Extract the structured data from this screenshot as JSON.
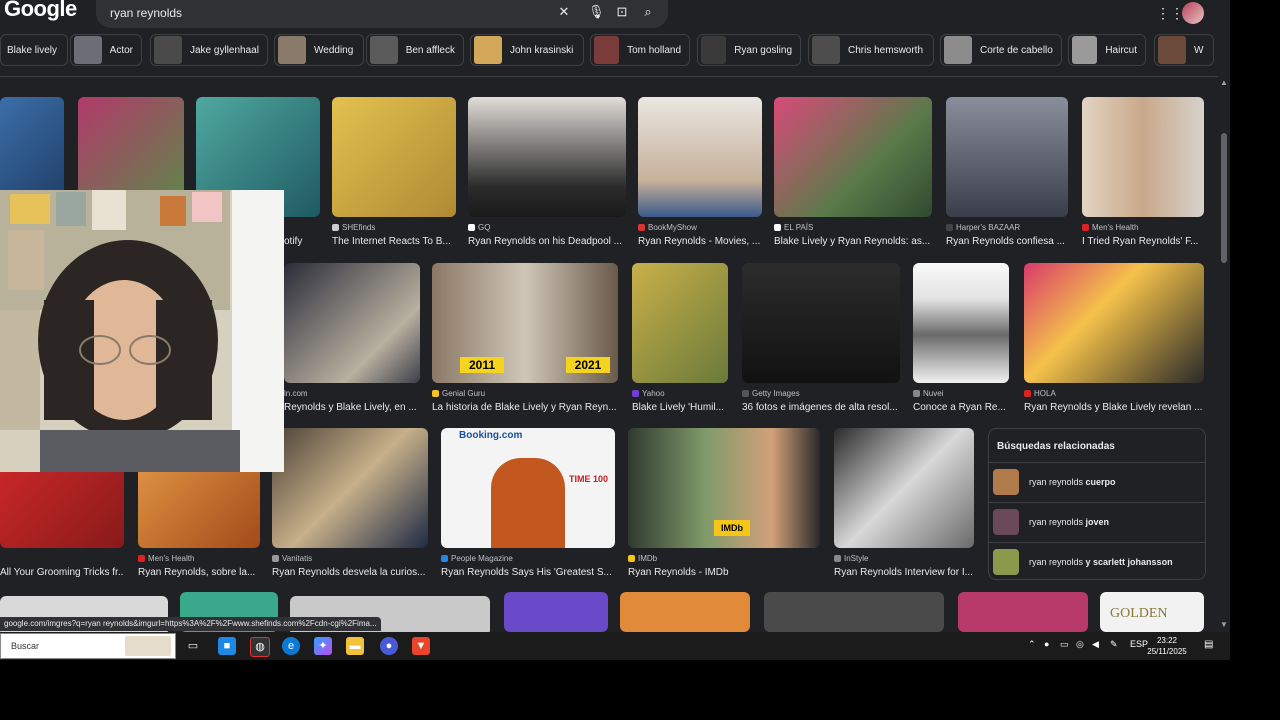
{
  "header": {
    "logo": "Google",
    "search_value": "ryan reynolds"
  },
  "chips": [
    {
      "label": "Blake lively",
      "color": "#2b2b2b"
    },
    {
      "label": "Actor",
      "color": "#6b6f75"
    },
    {
      "label": "Jake gyllenhaal",
      "color": "#4a4a4a"
    },
    {
      "label": "Wedding",
      "color": "#8a7a6a"
    },
    {
      "label": "Ben affleck",
      "color": "#5b5b5b"
    },
    {
      "label": "John krasinski",
      "color": "#d4a85a"
    },
    {
      "label": "Tom holland",
      "color": "#7a3b3b"
    },
    {
      "label": "Ryan gosling",
      "color": "#3a3a3a"
    },
    {
      "label": "Chris hemsworth",
      "color": "#4d4d4d"
    },
    {
      "label": "Corte de cabello",
      "color": "#8c8c8c"
    },
    {
      "label": "Haircut",
      "color": "#9a9a9a"
    },
    {
      "label": "W",
      "color": "#6b4a3a"
    }
  ],
  "row1": [
    {
      "source": "",
      "title": "",
      "color": "#3b6ea8"
    },
    {
      "source": "",
      "title": "",
      "color": "#b13a6a"
    },
    {
      "source": "",
      "title": "otify",
      "color": "#4fa8a0"
    },
    {
      "source": "SHEfinds",
      "title": "The Internet Reacts To B...",
      "color": "#d9b24a"
    },
    {
      "source": "GQ",
      "title": "Ryan Reynolds on his Deadpool ...",
      "color": "#d8d4cf"
    },
    {
      "source": "BookMyShow",
      "title": "Ryan Reynolds - Movies, ...",
      "color": "#e8e4e0"
    },
    {
      "source": "EL PAÍS",
      "title": "Blake Lively y Ryan Reynolds: as...",
      "color": "#9a4f7a"
    },
    {
      "source": "Harper's BAZAAR",
      "title": "Ryan Reynolds confiesa ...",
      "color": "#7a7e8a"
    },
    {
      "source": "Men's Health",
      "title": "I Tried Ryan Reynolds' F...",
      "color": "#d9cbbb"
    }
  ],
  "row2": [
    {
      "source": "ln.com",
      "title": "Reynolds y Blake Lively, en ...",
      "color": "#2a2c38"
    },
    {
      "source": "Genial Guru",
      "title": "La historia de Blake Lively y Ryan Reyn...",
      "color": "#8a7864"
    },
    {
      "source": "Yahoo",
      "title": "Blake Lively 'Humil...",
      "color": "#b9a24a"
    },
    {
      "source": "Getty Images",
      "title": "36 fotos e imágenes de alta resol...",
      "color": "#222222"
    },
    {
      "source": "Nuvei",
      "title": "Conoce a Ryan Re...",
      "color": "#f2f2f2"
    },
    {
      "source": "HOLA",
      "title": "Ryan Reynolds y Blake Lively revelan ...",
      "color": "#b23b5e"
    }
  ],
  "badges": {
    "left": "2011",
    "right": "2021"
  },
  "row3": [
    {
      "source": "",
      "title": "All Your Grooming Tricks fr...",
      "color": "#c42a2a"
    },
    {
      "source": "Men's Health",
      "title": "Ryan Reynolds, sobre la...",
      "color": "#d89a3a"
    },
    {
      "source": "Vanitatis",
      "title": "Ryan Reynolds desvela la curios...",
      "color": "#4a4136"
    },
    {
      "source": "People Magazine",
      "title": "Ryan Reynolds Says His 'Greatest S...",
      "color": "#f4f4f4"
    },
    {
      "source": "IMDb",
      "title": "Ryan Reynolds - IMDb",
      "color": "#3a3a3a"
    },
    {
      "source": "InStyle",
      "title": "Ryan Reynolds Interview for I...",
      "color": "#d8d8d8"
    }
  ],
  "people_overlay": {
    "brand": "Booking.com",
    "magazine": "TIME 100"
  },
  "imdb_overlay": "IMDb",
  "related": {
    "heading": "Búsquedas relacionadas",
    "items": [
      {
        "prefix": "ryan reynolds ",
        "bold": "cuerpo"
      },
      {
        "prefix": "ryan reynolds ",
        "bold": "joven"
      },
      {
        "prefix": "ryan reynolds ",
        "bold": "y scarlett johansson"
      }
    ]
  },
  "row4_overlay": "GOLDEN",
  "status_url": "google.com/imgres?q=ryan reynolds&imgurl=https%3A%2F%2Fwww.shefinds.com%2Fcdn-cgi%2Fima...",
  "taskbar": {
    "search_label": "Buscar",
    "lang": "ESP",
    "time": "23:22",
    "date": "25/11/2025"
  },
  "colors": {
    "background": "#202124",
    "text": "#e8eaed",
    "border": "#3c4043",
    "badge_yellow": "#f5d41f"
  }
}
